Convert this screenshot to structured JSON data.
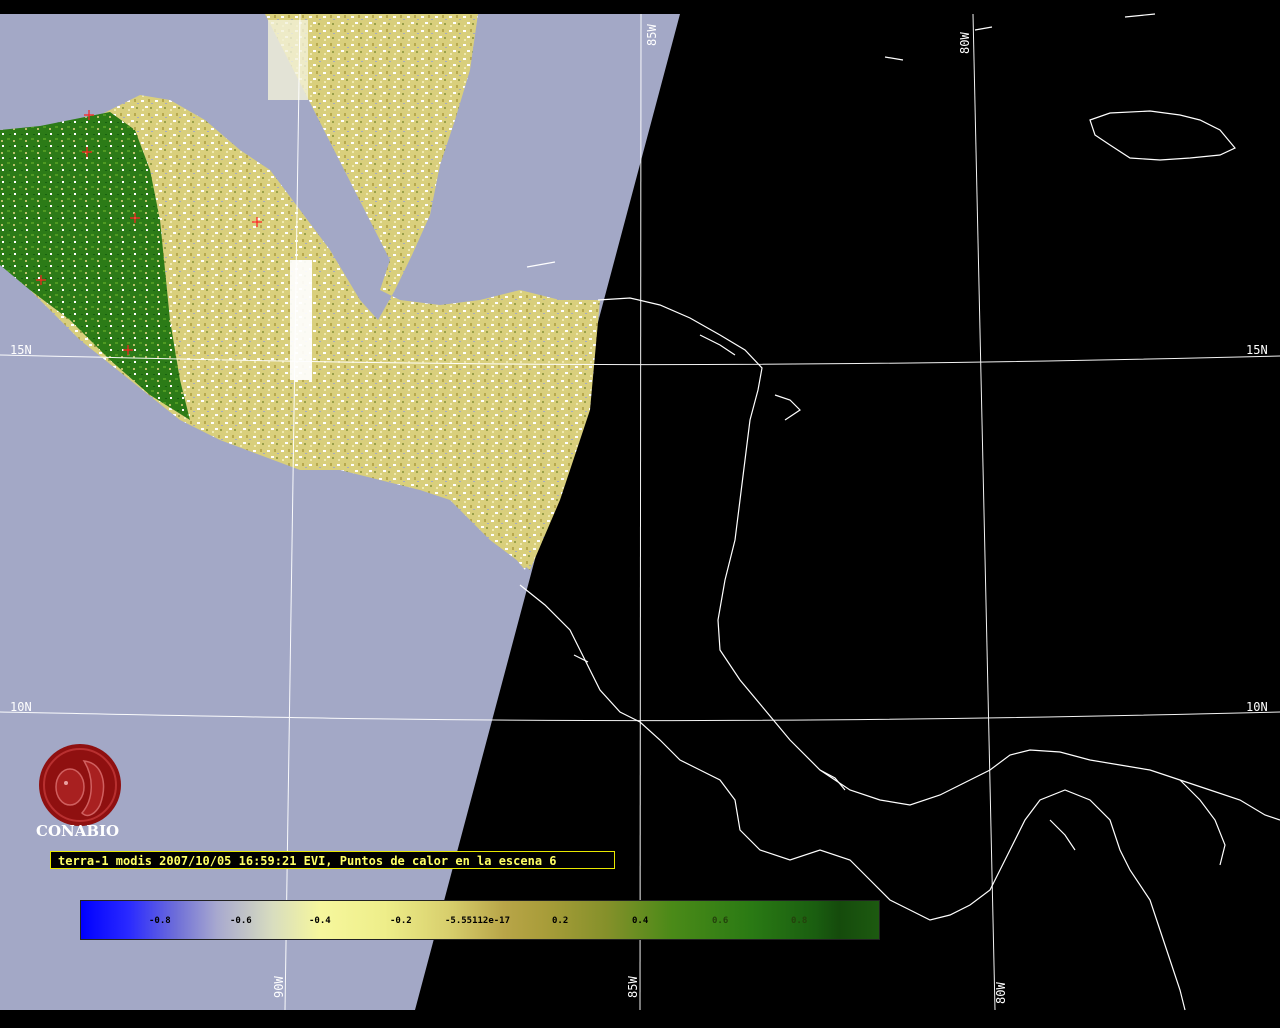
{
  "map": {
    "latitude_labels": [
      "15N",
      "10N"
    ],
    "longitude_labels": [
      "90W",
      "85W",
      "80W"
    ],
    "colors": {
      "no_data": "#a3a8c6",
      "background": "#000000",
      "coastline": "#ffffff",
      "graticule": "#ffffff",
      "hotspot": "#ff2020",
      "vegetation_high": "#1f7a10",
      "vegetation_low": "#e0d488"
    }
  },
  "logo": {
    "text": "CONABIO",
    "color": "#8f1010"
  },
  "caption": {
    "text": "terra-1 modis 2007/10/05 16:59:21 EVI, Puntos de calor en la escena 6"
  },
  "colorbar": {
    "ticks": [
      "-0.8",
      "-0.6",
      "-0.4",
      "-0.2",
      "-5.55112e-17",
      "0.2",
      "0.4",
      "0.6",
      "0.8"
    ],
    "range": [
      -1,
      1
    ],
    "end_markers": [
      "#ffffff",
      "#ffffff",
      "#ffd000",
      "#c00000"
    ]
  }
}
